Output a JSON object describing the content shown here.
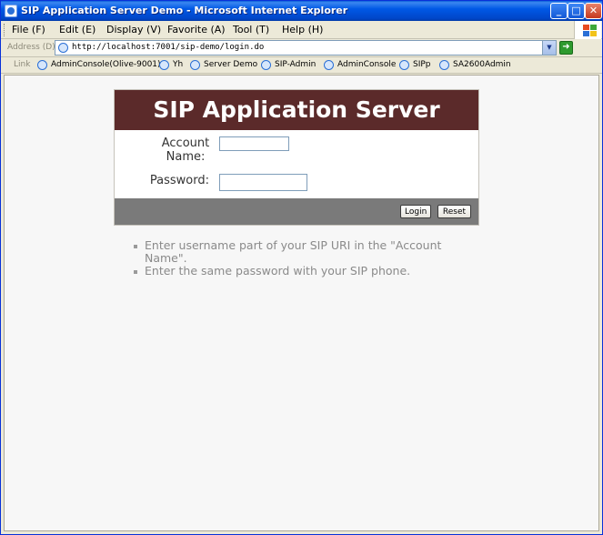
{
  "window": {
    "title": "SIP Application Server Demo - Microsoft Internet Explorer",
    "min_glyph": "_",
    "max_glyph": "□",
    "close_glyph": "✕"
  },
  "menu": {
    "items": [
      "File (F)",
      "Edit (E)",
      "Display (V)",
      "Favorite (A)",
      "Tool (T)",
      "Help (H)"
    ]
  },
  "address": {
    "label": "Address (D)",
    "url": "http://localhost:7001/sip-demo/login.do",
    "go_glyph": "➜"
  },
  "links": {
    "label": "Link",
    "items": [
      "AdminConsole(Olive-9001)",
      "Yh",
      "Server Demo",
      "SIP-Admin",
      "AdminConsole",
      "SIPp",
      "SA2600Admin"
    ]
  },
  "login": {
    "title": "SIP Application Server",
    "account_label": "Account Name:",
    "password_label": "Password:",
    "account_value": "",
    "password_value": "",
    "login_button": "Login",
    "reset_button": "Reset"
  },
  "hints": [
    "Enter username part of your SIP URI in the \"Account Name\".",
    "Enter the same password with your SIP phone."
  ],
  "colors": {
    "header_bg": "#5b2a2a",
    "footer_bg": "#7a7a7a",
    "hint_text": "#8a8a8a"
  }
}
